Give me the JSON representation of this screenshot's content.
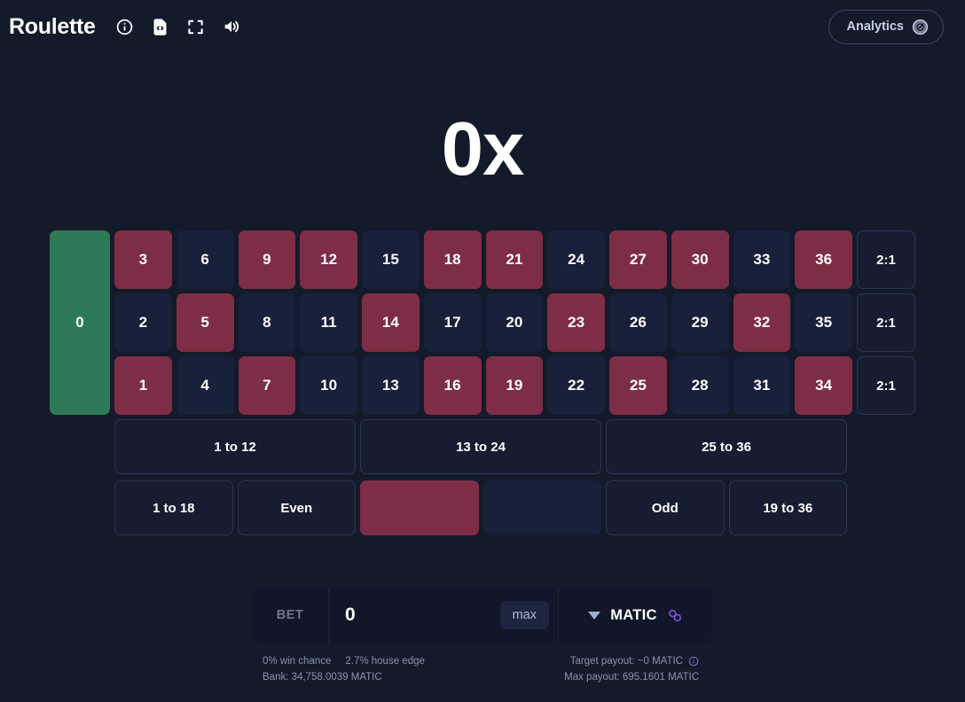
{
  "header": {
    "brand": "Roulette",
    "icons": [
      {
        "name": "info-icon",
        "label": "Info"
      },
      {
        "name": "code-file-icon",
        "label": "Provably fair"
      },
      {
        "name": "fullscreen-icon",
        "label": "Fullscreen"
      },
      {
        "name": "volume-icon",
        "label": "Sound"
      }
    ],
    "analytics_label": "Analytics"
  },
  "multiplier": "0x",
  "board": {
    "zero": "0",
    "column_bet_label": "2:1",
    "numbers": [
      {
        "n": "3",
        "color": "red"
      },
      {
        "n": "6",
        "color": "black"
      },
      {
        "n": "9",
        "color": "red"
      },
      {
        "n": "12",
        "color": "red"
      },
      {
        "n": "15",
        "color": "black"
      },
      {
        "n": "18",
        "color": "red"
      },
      {
        "n": "21",
        "color": "red"
      },
      {
        "n": "24",
        "color": "black"
      },
      {
        "n": "27",
        "color": "red"
      },
      {
        "n": "30",
        "color": "red"
      },
      {
        "n": "33",
        "color": "black"
      },
      {
        "n": "36",
        "color": "red"
      },
      {
        "n": "2",
        "color": "black"
      },
      {
        "n": "5",
        "color": "red"
      },
      {
        "n": "8",
        "color": "black"
      },
      {
        "n": "11",
        "color": "black"
      },
      {
        "n": "14",
        "color": "red"
      },
      {
        "n": "17",
        "color": "black"
      },
      {
        "n": "20",
        "color": "black"
      },
      {
        "n": "23",
        "color": "red"
      },
      {
        "n": "26",
        "color": "black"
      },
      {
        "n": "29",
        "color": "black"
      },
      {
        "n": "32",
        "color": "red"
      },
      {
        "n": "35",
        "color": "black"
      },
      {
        "n": "1",
        "color": "red"
      },
      {
        "n": "4",
        "color": "black"
      },
      {
        "n": "7",
        "color": "red"
      },
      {
        "n": "10",
        "color": "black"
      },
      {
        "n": "13",
        "color": "black"
      },
      {
        "n": "16",
        "color": "red"
      },
      {
        "n": "19",
        "color": "red"
      },
      {
        "n": "22",
        "color": "black"
      },
      {
        "n": "25",
        "color": "red"
      },
      {
        "n": "28",
        "color": "black"
      },
      {
        "n": "31",
        "color": "black"
      },
      {
        "n": "34",
        "color": "red"
      }
    ],
    "dozens": [
      "1 to 12",
      "13 to 24",
      "25 to 36"
    ],
    "outside": [
      {
        "label": "1 to 18",
        "style": "plain"
      },
      {
        "label": "Even",
        "style": "plain"
      },
      {
        "label": "",
        "style": "swatch-red"
      },
      {
        "label": "",
        "style": "swatch-black"
      },
      {
        "label": "Odd",
        "style": "plain"
      },
      {
        "label": "19 to 36",
        "style": "plain"
      }
    ]
  },
  "betbar": {
    "bet_label": "BET",
    "bet_value": "0",
    "bet_placeholder": "0",
    "max_label": "max",
    "token": "MATIC"
  },
  "stats": {
    "win_chance": "0% win chance",
    "house_edge": "2.7% house edge",
    "target_payout": "Target payout: ~0 MATIC",
    "bank": "Bank: 34,758.0039 MATIC",
    "max_payout": "Max payout: 695.1601 MATIC"
  },
  "colors": {
    "background": "#131a2a",
    "red": "#7d2d45",
    "black": "#18203a",
    "green": "#2e7a58",
    "accent_purple": "#7b4fe0"
  }
}
